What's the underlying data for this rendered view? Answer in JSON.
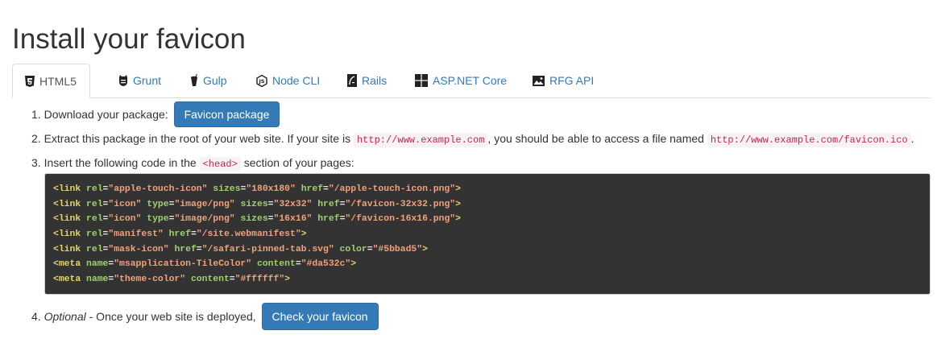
{
  "title": "Install your favicon",
  "tabs": [
    {
      "label": "HTML5",
      "icon": "html5-icon",
      "active": true
    },
    {
      "label": "Grunt",
      "icon": "grunt-icon",
      "active": false
    },
    {
      "label": "Gulp",
      "icon": "gulp-icon",
      "active": false
    },
    {
      "label": "Node CLI",
      "icon": "nodejs-icon",
      "active": false
    },
    {
      "label": "Rails",
      "icon": "rails-icon",
      "active": false
    },
    {
      "label": "ASP.NET Core",
      "icon": "windows-icon",
      "active": false
    },
    {
      "label": "RFG API",
      "icon": "api-icon",
      "active": false
    }
  ],
  "steps": {
    "step1": {
      "num": "1.",
      "text": "Download your package:",
      "button": "Favicon package"
    },
    "step2": {
      "num": "2.",
      "text_a": "Extract this package in the root of your web site. If your site is",
      "code_a": "http://www.example.com",
      "text_b": ", you should be able to access a file named",
      "code_b": "http://www.example.com/favicon.ico",
      "text_c": "."
    },
    "step3": {
      "num": "3.",
      "text_a": "Insert the following code in the",
      "code": "<head>",
      "text_b": "section of your pages:"
    },
    "step4": {
      "num": "4.",
      "italic": "Optional",
      "text": " - Once your web site is deployed,",
      "button": "Check your favicon"
    }
  },
  "code_lines": [
    {
      "tag": "link",
      "attrs": [
        [
          "rel",
          "\"apple-touch-icon\""
        ],
        [
          "sizes",
          "\"180x180\""
        ],
        [
          "href",
          "\"/apple-touch-icon.png\""
        ]
      ]
    },
    {
      "tag": "link",
      "attrs": [
        [
          "rel",
          "\"icon\""
        ],
        [
          "type",
          "\"image/png\""
        ],
        [
          "sizes",
          "\"32x32\""
        ],
        [
          "href",
          "\"/favicon-32x32.png\""
        ]
      ]
    },
    {
      "tag": "link",
      "attrs": [
        [
          "rel",
          "\"icon\""
        ],
        [
          "type",
          "\"image/png\""
        ],
        [
          "sizes",
          "\"16x16\""
        ],
        [
          "href",
          "\"/favicon-16x16.png\""
        ]
      ]
    },
    {
      "tag": "link",
      "attrs": [
        [
          "rel",
          "\"manifest\""
        ],
        [
          "href",
          "\"/site.webmanifest\""
        ]
      ]
    },
    {
      "tag": "link",
      "attrs": [
        [
          "rel",
          "\"mask-icon\""
        ],
        [
          "href",
          "\"/safari-pinned-tab.svg\""
        ],
        [
          "color",
          "\"#5bbad5\""
        ]
      ]
    },
    {
      "tag": "meta",
      "attrs": [
        [
          "name",
          "\"msapplication-TileColor\""
        ],
        [
          "content",
          "\"#da532c\""
        ]
      ]
    },
    {
      "tag": "meta",
      "attrs": [
        [
          "name",
          "\"theme-color\""
        ],
        [
          "content",
          "\"#ffffff\""
        ]
      ]
    }
  ],
  "colors": {
    "link": "#337ab7",
    "button": "#337ab7",
    "code_bg": "#333333",
    "inline_code_text": "#c7254e",
    "inline_code_bg": "#f9f2f4"
  }
}
